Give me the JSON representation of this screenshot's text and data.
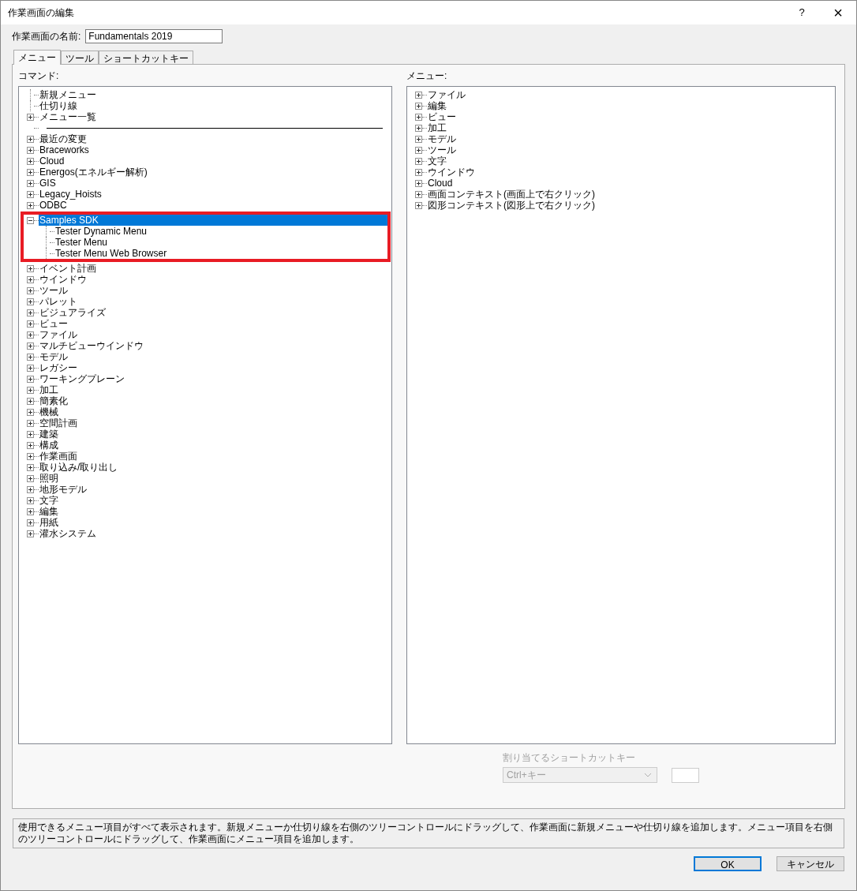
{
  "window": {
    "title": "作業画面の編集",
    "help": "?",
    "close": "×"
  },
  "name_field": {
    "label": "作業画面の名前:",
    "value": "Fundamentals 2019"
  },
  "tabs": [
    {
      "label": "メニュー",
      "selected": true
    },
    {
      "label": "ツール",
      "selected": false
    },
    {
      "label": "ショートカットキー",
      "selected": false
    }
  ],
  "commands": {
    "label": "コマンド:",
    "items": [
      {
        "kind": "command",
        "label": "新規メニュー",
        "selected": false
      },
      {
        "kind": "command",
        "label": "仕切り線",
        "selected": false
      },
      {
        "kind": "group",
        "label": "メニュー一覧",
        "expanded": false,
        "selected": false
      },
      {
        "kind": "separator"
      },
      {
        "kind": "group",
        "label": "最近の変更",
        "expanded": false,
        "selected": false
      },
      {
        "kind": "group",
        "label": "Braceworks",
        "expanded": false,
        "selected": false
      },
      {
        "kind": "group",
        "label": "Cloud",
        "expanded": false,
        "selected": false
      },
      {
        "kind": "group",
        "label": "Energos(エネルギー解析)",
        "expanded": false,
        "selected": false
      },
      {
        "kind": "group",
        "label": "GIS",
        "expanded": false,
        "selected": false
      },
      {
        "kind": "group",
        "label": "Legacy_Hoists",
        "expanded": false,
        "selected": false
      },
      {
        "kind": "group",
        "label": "ODBC",
        "expanded": false,
        "selected": false
      },
      {
        "kind": "group",
        "label": "Samples SDK",
        "expanded": true,
        "selected": true,
        "highlighted": true,
        "children": [
          {
            "kind": "command",
            "label": "Tester Dynamic Menu",
            "selected": false
          },
          {
            "kind": "command",
            "label": "Tester Menu",
            "selected": false
          },
          {
            "kind": "command",
            "label": "Tester Menu Web Browser",
            "selected": false
          }
        ]
      },
      {
        "kind": "group",
        "label": "イベント計画",
        "expanded": false,
        "selected": false
      },
      {
        "kind": "group",
        "label": "ウインドウ",
        "expanded": false,
        "selected": false
      },
      {
        "kind": "group",
        "label": "ツール",
        "expanded": false,
        "selected": false
      },
      {
        "kind": "group",
        "label": "パレット",
        "expanded": false,
        "selected": false
      },
      {
        "kind": "group",
        "label": "ビジュアライズ",
        "expanded": false,
        "selected": false
      },
      {
        "kind": "group",
        "label": "ビュー",
        "expanded": false,
        "selected": false
      },
      {
        "kind": "group",
        "label": "ファイル",
        "expanded": false,
        "selected": false
      },
      {
        "kind": "group",
        "label": "マルチビューウインドウ",
        "expanded": false,
        "selected": false
      },
      {
        "kind": "group",
        "label": "モデル",
        "expanded": false,
        "selected": false
      },
      {
        "kind": "group",
        "label": "レガシー",
        "expanded": false,
        "selected": false
      },
      {
        "kind": "group",
        "label": "ワーキングプレーン",
        "expanded": false,
        "selected": false
      },
      {
        "kind": "group",
        "label": "加工",
        "expanded": false,
        "selected": false
      },
      {
        "kind": "group",
        "label": "簡素化",
        "expanded": false,
        "selected": false
      },
      {
        "kind": "group",
        "label": "機械",
        "expanded": false,
        "selected": false
      },
      {
        "kind": "group",
        "label": "空間計画",
        "expanded": false,
        "selected": false
      },
      {
        "kind": "group",
        "label": "建築",
        "expanded": false,
        "selected": false
      },
      {
        "kind": "group",
        "label": "構成",
        "expanded": false,
        "selected": false
      },
      {
        "kind": "group",
        "label": "作業画面",
        "expanded": false,
        "selected": false
      },
      {
        "kind": "group",
        "label": "取り込み/取り出し",
        "expanded": false,
        "selected": false
      },
      {
        "kind": "group",
        "label": "照明",
        "expanded": false,
        "selected": false
      },
      {
        "kind": "group",
        "label": "地形モデル",
        "expanded": false,
        "selected": false
      },
      {
        "kind": "group",
        "label": "文字",
        "expanded": false,
        "selected": false
      },
      {
        "kind": "group",
        "label": "編集",
        "expanded": false,
        "selected": false
      },
      {
        "kind": "group",
        "label": "用紙",
        "expanded": false,
        "selected": false
      },
      {
        "kind": "group",
        "label": "灌水システム",
        "expanded": false,
        "selected": false
      }
    ]
  },
  "menus": {
    "label": "メニュー:",
    "items": [
      {
        "kind": "group",
        "label": "ファイル",
        "expanded": false,
        "selected": false
      },
      {
        "kind": "group",
        "label": "編集",
        "expanded": false,
        "selected": false
      },
      {
        "kind": "group",
        "label": "ビュー",
        "expanded": false,
        "selected": false
      },
      {
        "kind": "group",
        "label": "加工",
        "expanded": false,
        "selected": false
      },
      {
        "kind": "group",
        "label": "モデル",
        "expanded": false,
        "selected": false
      },
      {
        "kind": "group",
        "label": "ツール",
        "expanded": false,
        "selected": false
      },
      {
        "kind": "group",
        "label": "文字",
        "expanded": false,
        "selected": false
      },
      {
        "kind": "group",
        "label": "ウインドウ",
        "expanded": false,
        "selected": false
      },
      {
        "kind": "group",
        "label": "Cloud",
        "expanded": false,
        "selected": false
      },
      {
        "kind": "group",
        "label": "画面コンテキスト(画面上で右クリック)",
        "expanded": false,
        "selected": false
      },
      {
        "kind": "group",
        "label": "図形コンテキスト(図形上で右クリック)",
        "expanded": false,
        "selected": false
      }
    ]
  },
  "shortcut": {
    "label": "割り当てるショートカットキー",
    "modifier": "Ctrl+キー",
    "disabled": true
  },
  "description": "使用できるメニュー項目がすべて表示されます。新規メニューか仕切り線を右側のツリーコントロールにドラッグして、作業画面に新規メニューや仕切り線を追加します。メニュー項目を右側のツリーコントロールにドラッグして、作業画面にメニュー項目を追加します。",
  "buttons": [
    {
      "label": "OK",
      "default": true
    },
    {
      "label": "キャンセル",
      "default": false
    }
  ]
}
